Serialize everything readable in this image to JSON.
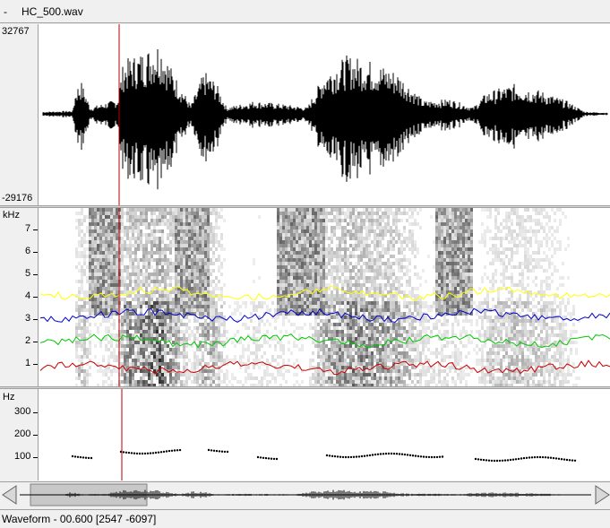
{
  "window": {
    "menu_glyph": "-",
    "file_name": "HC_500.wav"
  },
  "waveform": {
    "y_max_label": "32767",
    "y_min_label": "-29176"
  },
  "spectrogram": {
    "unit_label": "kHz",
    "ticks": [
      "7",
      "6",
      "5",
      "4",
      "3",
      "2",
      "1"
    ],
    "formant_colors": [
      "#ffff00",
      "#0000c8",
      "#00c800",
      "#c80000"
    ]
  },
  "pitch": {
    "unit_label": "Hz",
    "ticks": [
      "300",
      "200",
      "100"
    ]
  },
  "cursor": {
    "color": "#b40000"
  },
  "navigator": {
    "left_arrow_icon": "triangle-left-icon",
    "right_arrow_icon": "triangle-right-icon"
  },
  "status": {
    "text": "Waveform - 00.600 [2547 -6097]"
  }
}
